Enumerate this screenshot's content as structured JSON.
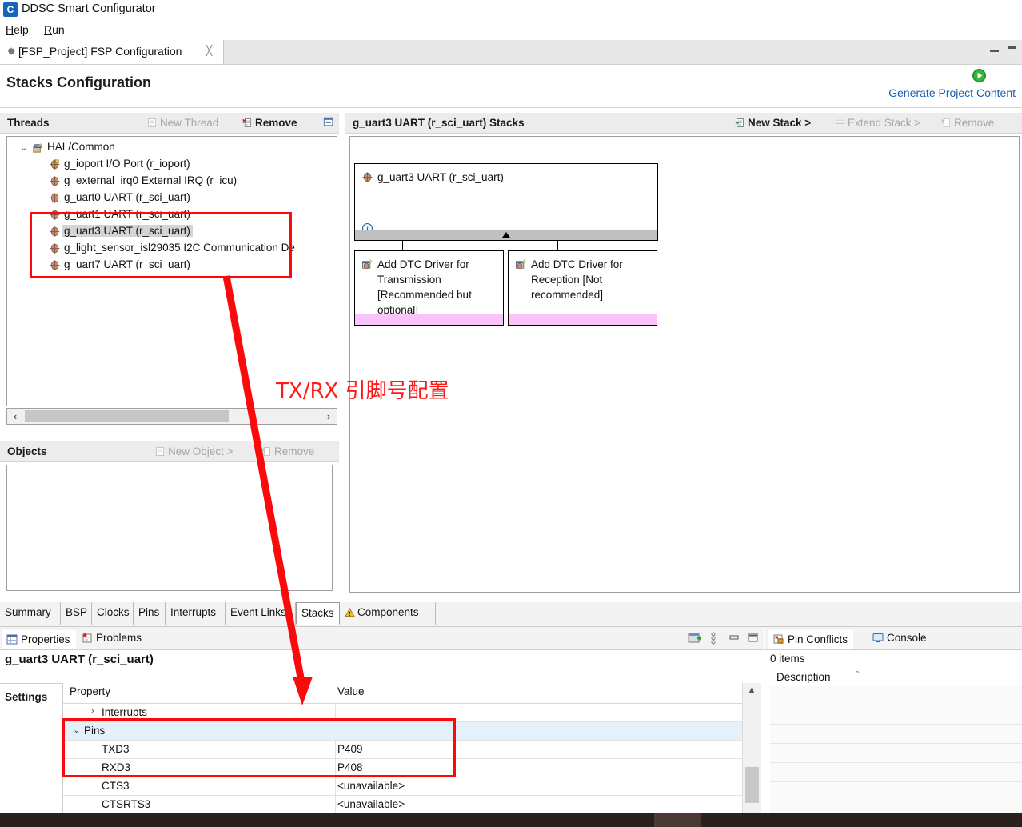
{
  "window": {
    "title": "DDSC Smart Configurator",
    "app_icon": "smart-configurator-logo-icon",
    "minimize_label": "minimize-icon",
    "maximize_label": "maximize-icon"
  },
  "menubar": {
    "items": [
      {
        "label": "Help"
      },
      {
        "label": "Run"
      }
    ]
  },
  "editor_tab": {
    "label": "[FSP_Project] FSP Configuration",
    "icon": "gear-icon",
    "close": "╳"
  },
  "page_header": {
    "title": "Stacks Configuration",
    "generate_link": "Generate Project Content",
    "generate_icon": "green-play-icon"
  },
  "threads": {
    "title": "Threads",
    "actions": [
      {
        "label": "New Thread",
        "enabled": false,
        "icon": "new-thread-icon"
      },
      {
        "label": "Remove",
        "enabled": true,
        "icon": "remove-icon"
      }
    ],
    "collapse_icon": "collapse-all-icon",
    "tree": [
      {
        "label": "HAL/Common",
        "depth": 0,
        "twisty": "⌄",
        "icon": "hal-common-icon",
        "selected": false
      },
      {
        "label": "g_ioport I/O Port (r_ioport)",
        "depth": 1,
        "icon": "module-icon",
        "selected": false
      },
      {
        "label": "g_external_irq0 External IRQ (r_icu)",
        "depth": 1,
        "icon": "module-icon",
        "selected": false
      },
      {
        "label": "g_uart0 UART (r_sci_uart)",
        "depth": 1,
        "icon": "module-icon",
        "selected": false
      },
      {
        "label": "g_uart1 UART (r_sci_uart)",
        "depth": 1,
        "icon": "module-icon",
        "selected": false
      },
      {
        "label": "g_uart3 UART (r_sci_uart)",
        "depth": 1,
        "icon": "module-icon",
        "selected": true
      },
      {
        "label": "g_light_sensor_isl29035 I2C Communication De",
        "depth": 1,
        "icon": "module-icon",
        "selected": false
      },
      {
        "label": "g_uart7 UART (r_sci_uart)",
        "depth": 1,
        "icon": "module-icon",
        "selected": false
      }
    ],
    "hscroll": {
      "left_arrow": "‹",
      "right_arrow": "›"
    }
  },
  "objects": {
    "title": "Objects",
    "actions": [
      {
        "label": "New Object >",
        "enabled": false,
        "icon": "new-object-icon"
      },
      {
        "label": "Remove",
        "enabled": false,
        "icon": "remove-icon"
      }
    ]
  },
  "stacks": {
    "title": "g_uart3 UART (r_sci_uart) Stacks",
    "actions": [
      {
        "label": "New Stack >",
        "enabled": true,
        "icon": "new-stack-icon"
      },
      {
        "label": "Extend Stack >",
        "enabled": false,
        "icon": "extend-stack-icon"
      },
      {
        "label": "Remove",
        "enabled": false,
        "icon": "remove-icon"
      }
    ],
    "root_box": {
      "label": "g_uart3 UART (r_sci_uart)",
      "icon": "module-icon",
      "info_icon": "info-icon"
    },
    "children": [
      {
        "label": "Add DTC Driver for Transmission [Recommended but optional]",
        "icon": "add-module-icon"
      },
      {
        "label": "Add DTC Driver for Reception [Not recommended]",
        "icon": "add-module-icon"
      }
    ]
  },
  "annotation": {
    "text": "TX/RX 引脚号配置",
    "color": "#ff1a1a"
  },
  "view_tabs": [
    {
      "label": "Summary",
      "active": false,
      "icon": null
    },
    {
      "label": "BSP",
      "active": false,
      "icon": null
    },
    {
      "label": "Clocks",
      "active": false,
      "icon": null
    },
    {
      "label": "Pins",
      "active": false,
      "icon": null
    },
    {
      "label": "Interrupts",
      "active": false,
      "icon": null
    },
    {
      "label": "Event Links",
      "active": false,
      "icon": null
    },
    {
      "label": "Stacks",
      "active": true,
      "icon": null
    },
    {
      "label": "Components",
      "active": false,
      "icon": "warning-icon"
    }
  ],
  "properties_view": {
    "tabs": [
      {
        "label": "Properties",
        "active": true,
        "icon": "properties-icon"
      },
      {
        "label": "Problems",
        "active": false,
        "icon": "problems-icon"
      }
    ],
    "toolbar": [
      {
        "name": "new-view-icon"
      },
      {
        "name": "view-menu-icon"
      },
      {
        "name": "minimize-icon"
      },
      {
        "name": "maximize-icon"
      }
    ],
    "title": "g_uart3 UART (r_sci_uart)",
    "side_tab": "Settings",
    "columns": {
      "property": "Property",
      "value": "Value"
    },
    "rows": [
      {
        "property": "Interrupts",
        "value": "",
        "depth": 1,
        "twisty": "›",
        "selected": false
      },
      {
        "property": "Pins",
        "value": "",
        "depth": 1,
        "twisty": "⌄",
        "selected": true
      },
      {
        "property": "TXD3",
        "value": "P409",
        "depth": 2,
        "twisty": "",
        "selected": false
      },
      {
        "property": "RXD3",
        "value": "P408",
        "depth": 2,
        "twisty": "",
        "selected": false
      },
      {
        "property": "CTS3",
        "value": "<unavailable>",
        "depth": 2,
        "twisty": "",
        "selected": false
      },
      {
        "property": "CTSRTS3",
        "value": "<unavailable>",
        "depth": 2,
        "twisty": "",
        "selected": false
      }
    ]
  },
  "pin_conflicts_view": {
    "tabs": [
      {
        "label": "Pin Conflicts",
        "active": true,
        "icon": "pin-conflicts-icon"
      },
      {
        "label": "Console",
        "active": false,
        "icon": "console-icon"
      }
    ],
    "items_count": "0 items",
    "column_description": "Description",
    "sort_caret": "⌃"
  },
  "colors": {
    "accent_link": "#1a5fb4",
    "annotation_red": "#fa0a0a",
    "pink_footer": "#fac3fa",
    "gray_footer": "#c0c0c0",
    "selection_blue": "#e4f0fa"
  }
}
